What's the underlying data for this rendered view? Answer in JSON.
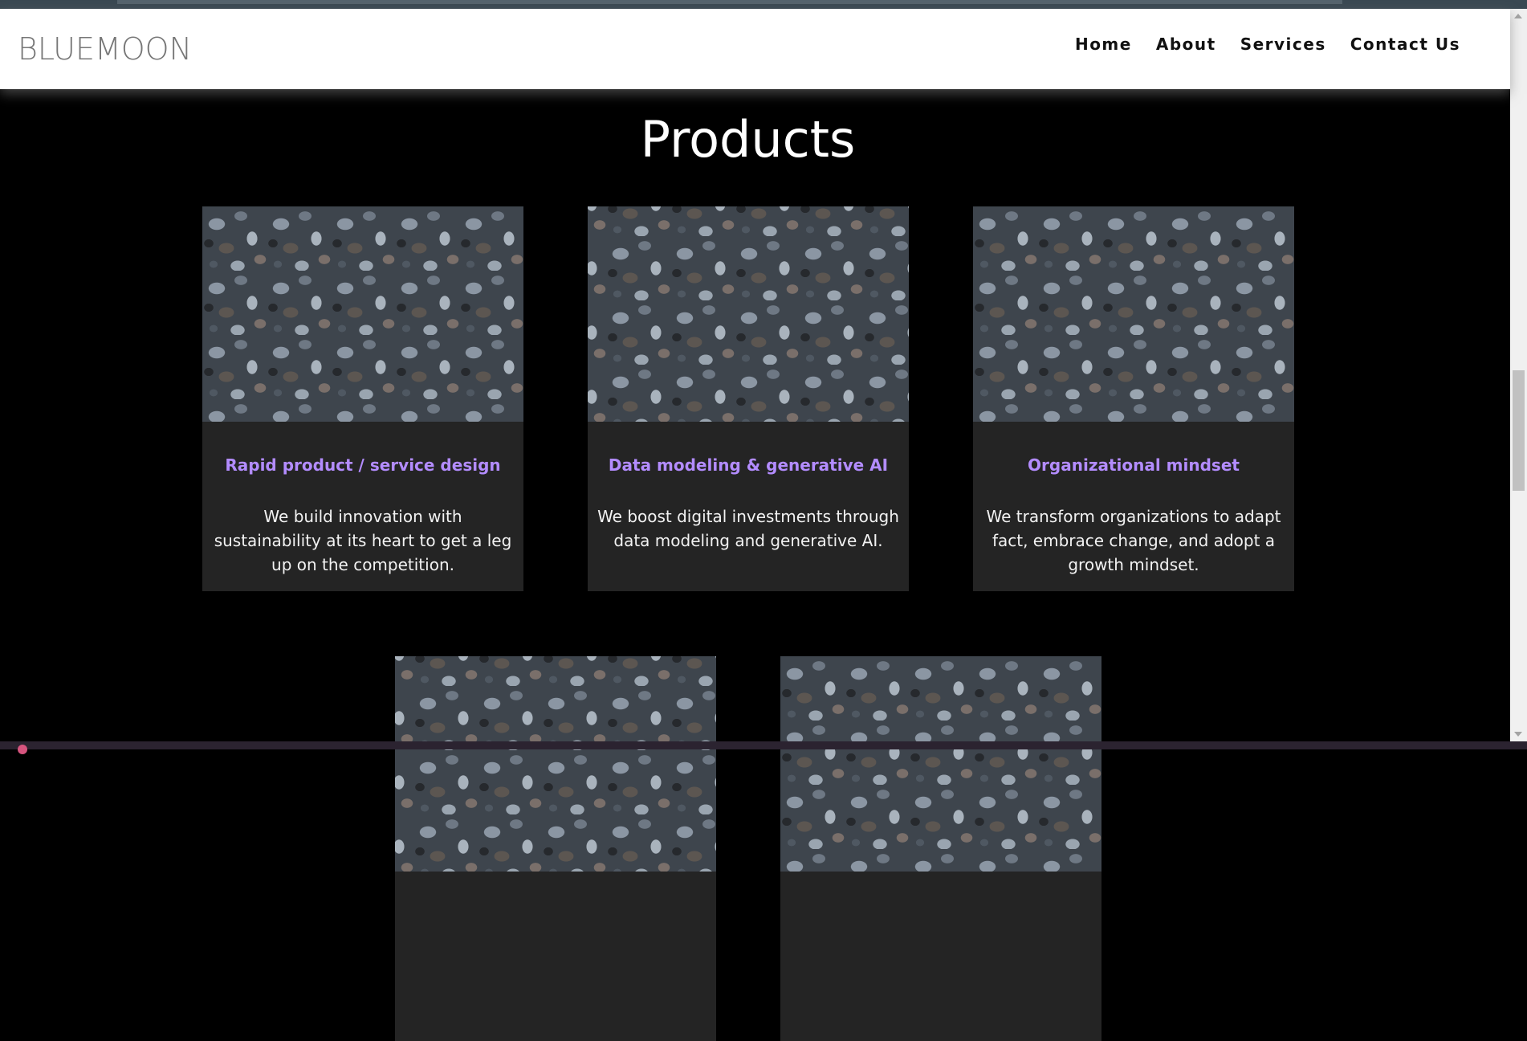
{
  "header": {
    "logo": "BLUEMOON",
    "nav": [
      "Home",
      "About",
      "Services",
      "Contact Us"
    ]
  },
  "products": {
    "title": "Products",
    "cards": [
      {
        "title": "Rapid product / service design",
        "text": "We build innovation with sustainability at its heart to get a leg up on the competition."
      },
      {
        "title": "Data modeling & generative AI",
        "text": "We boost digital investments through data modeling and generative AI."
      },
      {
        "title": "Organizational mindset",
        "text": "We transform organizations to adapt fact, embrace change, and adopt a growth mindset."
      },
      {
        "title": "",
        "text": ""
      },
      {
        "title": "",
        "text": ""
      }
    ]
  },
  "colors": {
    "background": "#000000",
    "card": "#242424",
    "card_title": "#b38cff",
    "navbar": "#ffffff"
  },
  "icons": [
    "scroll-up-arrow-icon",
    "scroll-down-arrow-icon"
  ]
}
